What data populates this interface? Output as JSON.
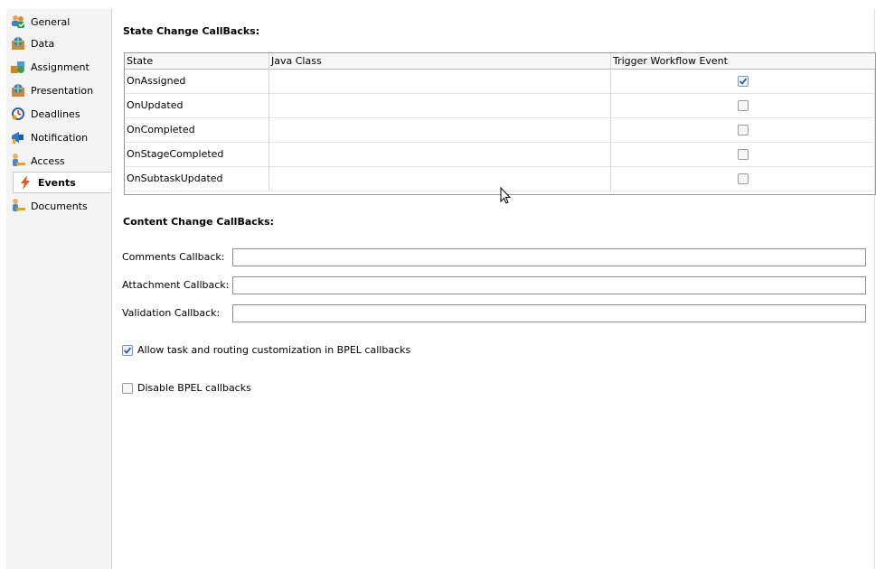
{
  "sidebar": {
    "items": [
      {
        "label": "General",
        "icon": "users-check-icon"
      },
      {
        "label": "Data",
        "icon": "globe-box-icon"
      },
      {
        "label": "Assignment",
        "icon": "assignment-icon"
      },
      {
        "label": "Presentation",
        "icon": "globe-box-icon"
      },
      {
        "label": "Deadlines",
        "icon": "clock-icon"
      },
      {
        "label": "Notification",
        "icon": "megaphone-icon"
      },
      {
        "label": "Access",
        "icon": "person-key-icon"
      },
      {
        "label": "Events",
        "icon": "lightning-icon"
      },
      {
        "label": "Documents",
        "icon": "person-key-icon"
      }
    ],
    "active": "Events"
  },
  "state_section": {
    "title": "State Change CallBacks:",
    "columns": [
      "State",
      "Java Class",
      "Trigger Workflow Event"
    ],
    "rows": [
      {
        "state": "OnAssigned",
        "java_class": "",
        "trigger": true
      },
      {
        "state": "OnUpdated",
        "java_class": "",
        "trigger": false
      },
      {
        "state": "OnCompleted",
        "java_class": "",
        "trigger": false
      },
      {
        "state": "OnStageCompleted",
        "java_class": "",
        "trigger": false
      },
      {
        "state": "OnSubtaskUpdated",
        "java_class": "",
        "trigger": false
      }
    ]
  },
  "content_section": {
    "title": "Content Change CallBacks:",
    "fields": [
      {
        "label": "Comments Callback:",
        "value": ""
      },
      {
        "label": "Attachment Callback:",
        "value": ""
      },
      {
        "label": "Validation Callback:",
        "value": ""
      }
    ]
  },
  "options": {
    "allow_customization": {
      "label": "Allow task and routing customization in BPEL callbacks",
      "checked": true
    },
    "disable_bpel": {
      "label": "Disable BPEL callbacks",
      "checked": false
    }
  },
  "colors": {
    "sidebar_bg": "#f4f4f4",
    "check_blue": "#2f5fa8",
    "border": "#9a9a9a"
  }
}
